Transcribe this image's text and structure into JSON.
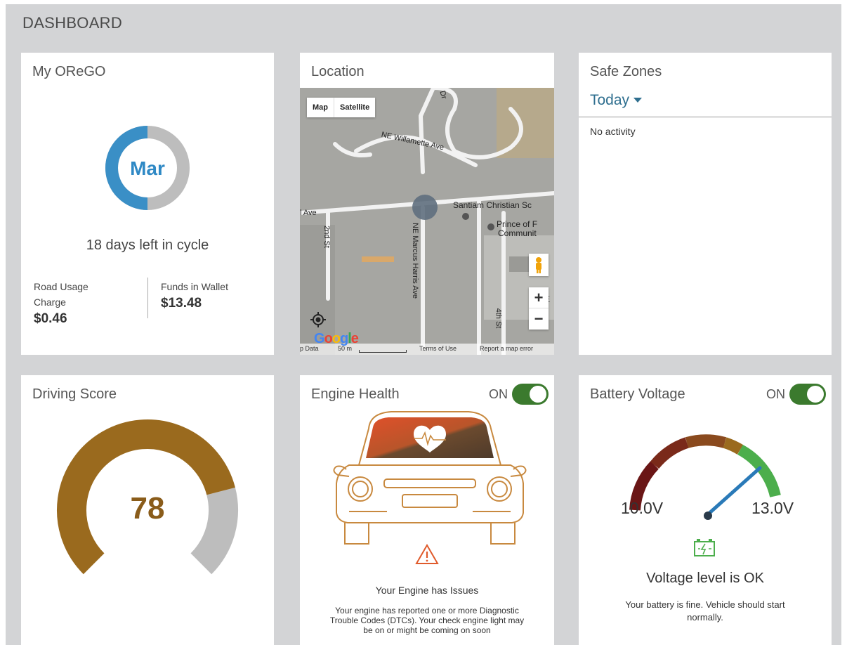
{
  "page": {
    "title": "DASHBOARD"
  },
  "orego": {
    "title": "My OReGO",
    "month": "Mar",
    "cycle_text": "18 days left in cycle",
    "road_usage_label_1": "Road Usage",
    "road_usage_label_2": "Charge",
    "road_usage_value": "$0.46",
    "funds_label": "Funds in Wallet",
    "funds_value": "$13.48",
    "cycle_fraction": 0.5,
    "colors": {
      "progress": "#3a8fc6",
      "track": "#bdbdbd",
      "text": "#2f89c5"
    }
  },
  "location": {
    "title": "Location",
    "map_button": "Map",
    "satellite_button": "Satellite",
    "zoom_in": "+",
    "zoom_out": "−",
    "google_logo": "Google",
    "footer_left": "p Data",
    "footer_scale": "50 m",
    "terms": "Terms of Use",
    "report": "Report a map error",
    "streets": {
      "dr": "Dr",
      "willamette": "NE Willamette Ave",
      "ave": "l Ave",
      "second": "2nd St",
      "marcus": "NE Marcus Harris Ave",
      "fourth": "4th St",
      "santiam": "Santiam Christian Sc",
      "prince_1": "Prince of F",
      "prince_2": "Communit",
      "e": "E"
    }
  },
  "safezones": {
    "title": "Safe Zones",
    "filter": "Today",
    "empty_text": "No activity",
    "colors": {
      "filter": "#2f6f8f"
    }
  },
  "driving": {
    "title": "Driving Score",
    "score": "78",
    "score_value": 78,
    "colors": {
      "fill": "#9a6a1e",
      "track": "#bdbdbd"
    }
  },
  "engine": {
    "title": "Engine Health",
    "toggle_label": "ON",
    "issue_title": "Your Engine has Issues",
    "issue_text_1": "Your engine has reported one or more Diagnostic",
    "issue_text_2": "Trouble Codes (DTCs). Your check engine light may",
    "issue_text_3": "be on or might be coming on soon",
    "colors": {
      "line": "#c8893f",
      "warning": "#e05a2b"
    }
  },
  "battery": {
    "title": "Battery Voltage",
    "toggle_label": "ON",
    "min_label": "10.0V",
    "max_label": "13.0V",
    "status": "Voltage level is OK",
    "desc_1": "Your battery is fine. Vehicle should start",
    "desc_2": "normally.",
    "colors": {
      "needle": "#2a7ab8",
      "ok": "#4cae4c"
    }
  }
}
